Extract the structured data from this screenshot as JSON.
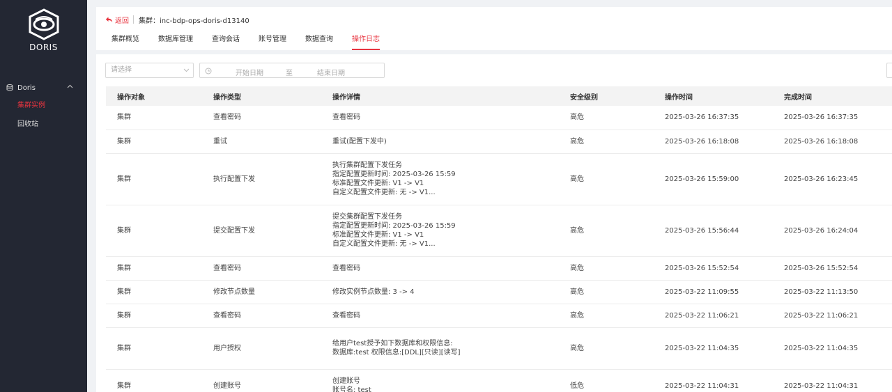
{
  "sidebar": {
    "logo_text": "DORIS",
    "group_label": "Doris",
    "items": [
      {
        "label": "集群实例",
        "active": true
      },
      {
        "label": "回收站",
        "active": false
      }
    ]
  },
  "header": {
    "back_label": "返回",
    "cluster_label": "集群：inc-bdp-ops-doris-d13140",
    "tabs": [
      "集群概览",
      "数据库管理",
      "查询会话",
      "账号管理",
      "数据查询",
      "操作日志"
    ],
    "active_tab": 5
  },
  "filters": {
    "select_placeholder": "请选择",
    "start_placeholder": "开始日期",
    "range_separator": "至",
    "end_placeholder": "结束日期"
  },
  "table": {
    "columns": [
      "操作对象",
      "操作类型",
      "操作详情",
      "安全级别",
      "操作时间",
      "完成时间"
    ],
    "rows": [
      {
        "object": "集群",
        "type": "查看密码",
        "details": [
          "查看密码"
        ],
        "level": "高危",
        "op_time": "2025-03-26 16:37:35",
        "done_time": "2025-03-26 16:37:35"
      },
      {
        "object": "集群",
        "type": "重试",
        "details": [
          "重试(配置下发中)"
        ],
        "level": "高危",
        "op_time": "2025-03-26 16:18:08",
        "done_time": "2025-03-26 16:18:08"
      },
      {
        "object": "集群",
        "type": "执行配置下发",
        "details": [
          "执行集群配置下发任务",
          "指定配置更新时间: 2025-03-26 15:59",
          "标准配置文件更新: V1 -> V1",
          "自定义配置文件更新: 无 -> V1..."
        ],
        "level": "高危",
        "op_time": "2025-03-26 15:59:00",
        "done_time": "2025-03-26 16:23:45"
      },
      {
        "object": "集群",
        "type": "提交配置下发",
        "details": [
          "提交集群配置下发任务",
          "指定配置更新时间: 2025-03-26 15:59",
          "标准配置文件更新: V1 -> V1",
          "自定义配置文件更新: 无 -> V1..."
        ],
        "level": "高危",
        "op_time": "2025-03-26 15:56:44",
        "done_time": "2025-03-26 16:24:04"
      },
      {
        "object": "集群",
        "type": "查看密码",
        "details": [
          "查看密码"
        ],
        "level": "高危",
        "op_time": "2025-03-26 15:52:54",
        "done_time": "2025-03-26 15:52:54"
      },
      {
        "object": "集群",
        "type": "修改节点数量",
        "details": [
          "修改实例节点数量: 3 -> 4"
        ],
        "level": "高危",
        "op_time": "2025-03-22 11:09:55",
        "done_time": "2025-03-22 11:13:50"
      },
      {
        "object": "集群",
        "type": "查看密码",
        "details": [
          "查看密码"
        ],
        "level": "高危",
        "op_time": "2025-03-22 11:06:21",
        "done_time": "2025-03-22 11:06:21"
      },
      {
        "object": "集群",
        "type": "用户授权",
        "details": [
          "给用户test授予如下数据库和权限信息:",
          "数据库:test 权限信息:[DDL][只读][读写]"
        ],
        "level": "高危",
        "op_time": "2025-03-22 11:04:35",
        "done_time": "2025-03-22 11:04:35"
      },
      {
        "object": "集群",
        "type": "创建账号",
        "details": [
          "创建账号",
          "账号名: test"
        ],
        "level": "低危",
        "op_time": "2025-03-22 11:04:31",
        "done_time": "2025-03-22 11:04:31"
      }
    ]
  }
}
